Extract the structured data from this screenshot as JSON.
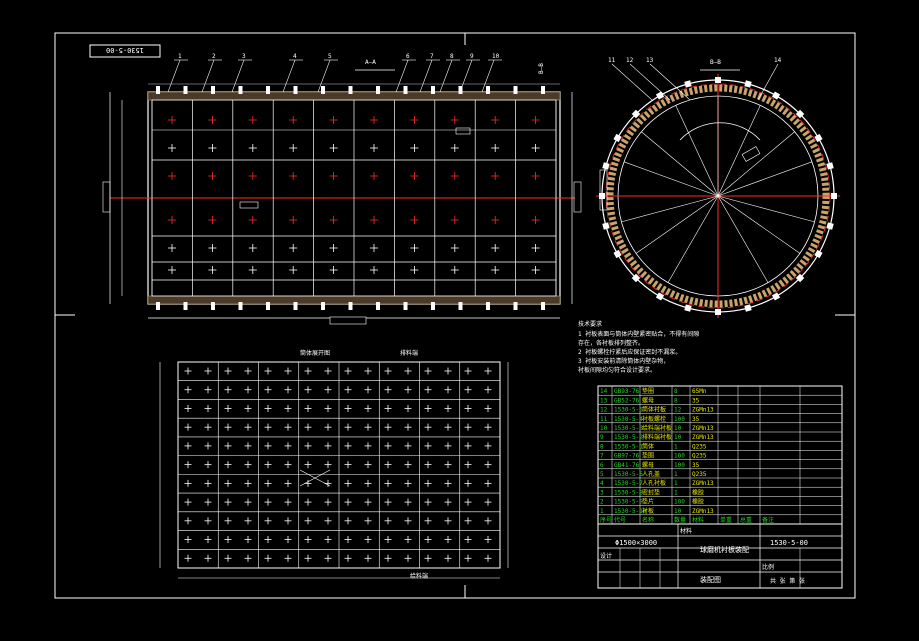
{
  "drawing_number": "1530-5-00",
  "drawing_number_left": "1530-5-00",
  "section_top": "A—A",
  "section_side": "B—B",
  "callouts": [
    "1",
    "2",
    "3",
    "4",
    "5",
    "6",
    "7",
    "8",
    "9",
    "10"
  ],
  "callouts_right": [
    "11",
    "12",
    "13",
    "14"
  ],
  "tech_req": {
    "title": "技术要求",
    "lines": [
      "1 衬板表面与筒体内壁紧密贴合，不得有间隙",
      "  存在，各衬板排列整齐。",
      "2 衬板螺栓拧紧后应保证密封不漏浆。",
      "3 衬板安装前清除筒体内壁杂物，",
      "  衬板间隙均匀符合设计要求。"
    ]
  },
  "bottom_view_labels": [
    "筒体展开图",
    "给料端",
    "排料端"
  ],
  "title_block": {
    "spec": "Φ1500×3000",
    "name": "球磨机衬板装配",
    "code": "1530-5-00",
    "company": "装配图",
    "designer": "设计",
    "material": "材料",
    "scale": "比例",
    "sheet": "共 张 第 张"
  },
  "bom": [
    {
      "no": "14",
      "code": "GB93-76",
      "name": "垫圈",
      "qty": "8",
      "mat": "65Mn"
    },
    {
      "no": "13",
      "code": "GB52-76",
      "name": "螺母",
      "qty": "8",
      "mat": "35"
    },
    {
      "no": "12",
      "code": "1530-5-5",
      "name": "筒体衬板",
      "qty": "12",
      "mat": "ZGMn13"
    },
    {
      "no": "11",
      "code": "1530-5-4",
      "name": "衬板螺栓",
      "qty": "100",
      "mat": "35"
    },
    {
      "no": "10",
      "code": "1530-5-3",
      "name": "给料端衬板",
      "qty": "10",
      "mat": "ZGMn13"
    },
    {
      "no": "9",
      "code": "1530-5-2",
      "name": "排料端衬板",
      "qty": "10",
      "mat": "ZGMn13"
    },
    {
      "no": "8",
      "code": "1530-5-1",
      "name": "筒体",
      "qty": "1",
      "mat": "Q235"
    },
    {
      "no": "7",
      "code": "GB97-76",
      "name": "垫圈",
      "qty": "100",
      "mat": "Q235"
    },
    {
      "no": "6",
      "code": "GB41-76",
      "name": "螺母",
      "qty": "100",
      "mat": "35"
    },
    {
      "no": "5",
      "code": "1530-5-6",
      "name": "人孔盖",
      "qty": "1",
      "mat": "Q235"
    },
    {
      "no": "4",
      "code": "1530-5-7",
      "name": "人孔衬板",
      "qty": "1",
      "mat": "ZGMn13"
    },
    {
      "no": "3",
      "code": "1530-5-8",
      "name": "密封垫",
      "qty": "1",
      "mat": "橡胶"
    },
    {
      "no": "2",
      "code": "1530-5-9",
      "name": "垫片",
      "qty": "100",
      "mat": "橡胶"
    },
    {
      "no": "1",
      "code": "1530-5-10",
      "name": "衬板",
      "qty": "10",
      "mat": "ZGMn13"
    }
  ],
  "bom_header": [
    "序号",
    "代号",
    "名称",
    "数量",
    "材料",
    "单重",
    "总重",
    "备注"
  ],
  "colors": {
    "line": "#ffffff",
    "red": "#ff2a2a",
    "green": "#22d022",
    "yellow": "#e6e600",
    "blue": "#3a5cff",
    "bg": "#000000"
  }
}
